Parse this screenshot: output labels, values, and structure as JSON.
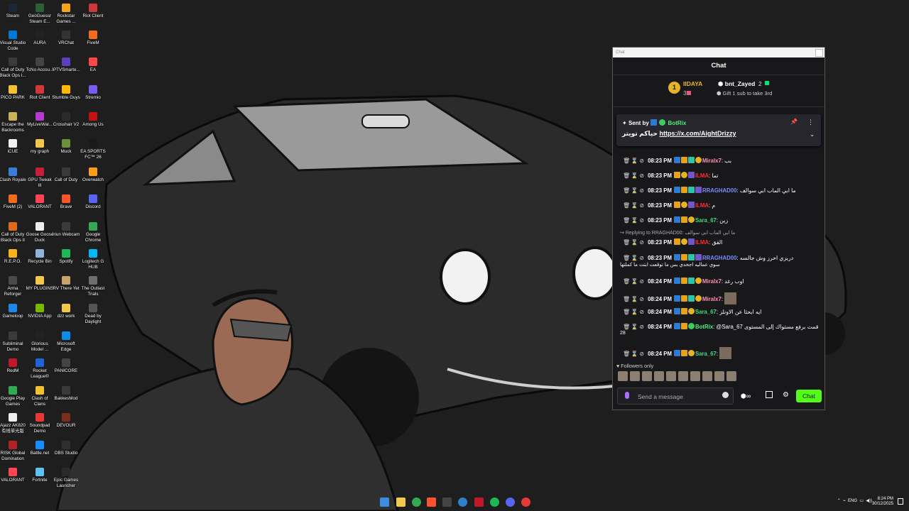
{
  "desktop_icons": [
    {
      "label": "Steam",
      "color": "#1b2838"
    },
    {
      "label": "GeoGuessr Steam E...",
      "color": "#2c5e35"
    },
    {
      "label": "Rockstar Games ...",
      "color": "#f4a51c"
    },
    {
      "label": "Riot Client",
      "color": "#d13639"
    },
    {
      "label": "Visual Studio Code",
      "color": "#0078d4"
    },
    {
      "label": "AURA",
      "color": "#222222"
    },
    {
      "label": "VRChat",
      "color": "#333333"
    },
    {
      "label": "FiveM",
      "color": "#f26b1d"
    },
    {
      "label": "Call of Duty Black Ops I...",
      "color": "#3a3a3a"
    },
    {
      "label": "TcNo Accou...",
      "color": "#444444"
    },
    {
      "label": "IPTVSmarte...",
      "color": "#5b3fbf"
    },
    {
      "label": "EA",
      "color": "#ff4747"
    },
    {
      "label": "PICO PARK",
      "color": "#f2c230"
    },
    {
      "label": "Riot Client",
      "color": "#d13639"
    },
    {
      "label": "Stumble Guys",
      "color": "#ffb800"
    },
    {
      "label": "Stremio",
      "color": "#7b5bf5"
    },
    {
      "label": "Escape the Backrooms",
      "color": "#c9b25a"
    },
    {
      "label": "MyLiveWal...",
      "color": "#b73ad1"
    },
    {
      "label": "Crosshair V2",
      "color": "#2b2b2b"
    },
    {
      "label": "Among Us",
      "color": "#c51111"
    },
    {
      "label": "iCUE",
      "color": "#f2f2f2"
    },
    {
      "label": "my graph",
      "color": "#f3c74b"
    },
    {
      "label": "Muck",
      "color": "#6c8f3d"
    },
    {
      "label": "EA SPORTS FC™ 26",
      "color": "#1a1a1a"
    },
    {
      "label": "Clash Royale",
      "color": "#3d7dd8"
    },
    {
      "label": "GPU Tweak III",
      "color": "#c41e3a"
    },
    {
      "label": "Call of Duty",
      "color": "#3a3a3a"
    },
    {
      "label": "Overwatch",
      "color": "#f99e1a"
    },
    {
      "label": "FiveM (2)",
      "color": "#f26b1d"
    },
    {
      "label": "VALORANT",
      "color": "#ff4655"
    },
    {
      "label": "Brave",
      "color": "#fb542b"
    },
    {
      "label": "Discord",
      "color": "#5865f2"
    },
    {
      "label": "Call of Duty Black Ops II",
      "color": "#e06a1b"
    },
    {
      "label": "Goose Goose Duck",
      "color": "#eeeeee"
    },
    {
      "label": "Iriun Webcam",
      "color": "#3a3a3a"
    },
    {
      "label": "Google Chrome",
      "color": "#34a853"
    },
    {
      "label": "R.E.P.O.",
      "color": "#f6b31c"
    },
    {
      "label": "Recycle Bin",
      "color": "#8fb3d9"
    },
    {
      "label": "Spotify",
      "color": "#1db954"
    },
    {
      "label": "Logitech G HUB",
      "color": "#00b8fc"
    },
    {
      "label": "Arma Reforger",
      "color": "#4a4a4a"
    },
    {
      "label": "MY PLUGINS",
      "color": "#f3c74b"
    },
    {
      "label": "RV There Yet",
      "color": "#c9a36b"
    },
    {
      "label": "The Outlast Trials",
      "color": "#6e6e6e"
    },
    {
      "label": "Gameloop",
      "color": "#1e88e5"
    },
    {
      "label": "NVIDIA App",
      "color": "#76b900"
    },
    {
      "label": "dzz work",
      "color": "#f3c74b"
    },
    {
      "label": "Dead by Daylight",
      "color": "#555555"
    },
    {
      "label": "Subliminal Demo",
      "color": "#3a3a3a"
    },
    {
      "label": "Glorious Model ...",
      "color": "#222222"
    },
    {
      "label": "Microsoft Edge",
      "color": "#0c8ce9"
    },
    {
      "label": "",
      "color": "transparent"
    },
    {
      "label": "RedM",
      "color": "#c0172b"
    },
    {
      "label": "Rocket League®",
      "color": "#1f62d9"
    },
    {
      "label": "PANICORE",
      "color": "#444444"
    },
    {
      "label": "",
      "color": "transparent"
    },
    {
      "label": "Google Play Games",
      "color": "#34a853"
    },
    {
      "label": "Clash of Clans",
      "color": "#f2c230"
    },
    {
      "label": "BakkesMod",
      "color": "#3a3a3a"
    },
    {
      "label": "",
      "color": "transparent"
    },
    {
      "label": "Ajazz AK820 有线单光版",
      "color": "#eeeeee"
    },
    {
      "label": "Soundpad Demo",
      "color": "#e53935"
    },
    {
      "label": "DEVOUR",
      "color": "#7a2d1a"
    },
    {
      "label": "",
      "color": "transparent"
    },
    {
      "label": "RISK Global Domination",
      "color": "#b22222"
    },
    {
      "label": "Battle.net",
      "color": "#148eff"
    },
    {
      "label": "OBS Studio",
      "color": "#302e31"
    },
    {
      "label": "",
      "color": "transparent"
    },
    {
      "label": "VALORANT",
      "color": "#ff4655"
    },
    {
      "label": "Fortnite",
      "color": "#5ec1f2"
    },
    {
      "label": "Epic Games Launcher",
      "color": "#2a2a2a"
    }
  ],
  "chat": {
    "window_title": "Chat",
    "header_title": "Chat",
    "leaderboard": {
      "rank": "1",
      "top_user": "IIDAYA",
      "top_count": "30",
      "second_user": "bnt_Zayed",
      "second_count": "2",
      "note": "Gift 1 sub to take 3rd"
    },
    "pinned": {
      "sent_by": "Sent by",
      "sender": "BotRix",
      "text": "حياكم تويتر",
      "url": "https://x.com/AightDrizzy"
    },
    "messages": [
      {
        "time": "08:23 PM",
        "user": "Miralx7",
        "color": "#ff8fb3",
        "text": ": بب"
      },
      {
        "time": "08:23 PM",
        "user": "ILMA",
        "color": "#ff2d2d",
        "text": ": تما"
      },
      {
        "time": "08:23 PM",
        "user": "RRAGHAD00",
        "color": "#7a8cff",
        "text": ": ما ابي الماب ابي سوالف"
      },
      {
        "time": "08:23 PM",
        "user": "ILMA",
        "color": "#ff2d2d",
        "text": ": م"
      },
      {
        "time": "08:23 PM",
        "user": "Sara_67",
        "color": "#3ddc84",
        "text": ": زين"
      },
      {
        "time": "08:23 PM",
        "user": "ILMA",
        "color": "#ff2d2d",
        "text": ": القق"
      },
      {
        "time": "08:23 PM",
        "user": "RRAGHAD00",
        "color": "#7a8cff",
        "text": ": دريزي احرز وش جالسه"
      },
      {
        "time": "08:24 PM",
        "user": "Miralx7",
        "color": "#ff8fb3",
        "text": ": اوب رغد"
      },
      {
        "time": "08:24 PM",
        "user": "Miralx7",
        "color": "#ff8fb3",
        "text": ":"
      },
      {
        "time": "08:24 PM",
        "user": "Sara_67",
        "color": "#3ddc84",
        "text": ": ايه ابحثا عن الاونلز"
      },
      {
        "time": "08:24 PM",
        "user": "BotRix",
        "color": "#4ef07b",
        "text": ": @Sara_67 قمت برفع مستواك إلى المستوى"
      },
      {
        "time": "08:24 PM",
        "user": "Sara_67",
        "color": "#3ddc84",
        "text": ":"
      }
    ],
    "reply_label": "Replying to RRAGHAD00:",
    "reply_text": "ما ابي الماب ابي سوالف",
    "msg7_continuation": "سوي عماليه اجحدي بس ما توقعت ابتت ما كملتها",
    "msg11_continuation": "28",
    "followers_only": "Followers only",
    "input_placeholder": "Send a message",
    "chat_button": "Chat"
  },
  "taskbar": {
    "tray_lang": "ENG",
    "clock_time": "8:24 PM",
    "clock_date": "30/12/2025"
  }
}
